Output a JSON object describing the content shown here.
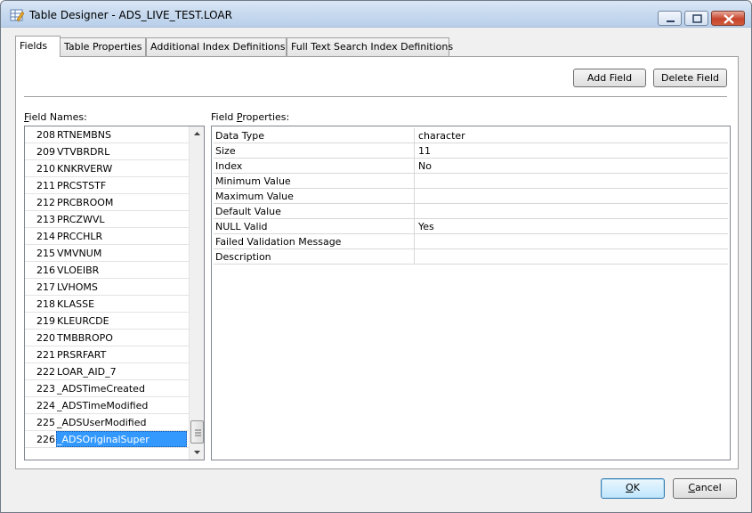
{
  "window": {
    "title": "Table Designer - ADS_LIVE_TEST.LOAR"
  },
  "tabs": [
    {
      "label": "Fields",
      "active": true
    },
    {
      "label": "Table Properties",
      "active": false
    },
    {
      "label": "Additional Index Definitions",
      "active": false
    },
    {
      "label": "Full Text Search Index Definitions",
      "active": false
    }
  ],
  "toolbar": {
    "add_field": "Add Field",
    "delete_field": "Delete Field"
  },
  "field_names": {
    "label_accel": "F",
    "label_rest": "ield Names:",
    "rows": [
      {
        "num": "208",
        "name": "RTNEMBNS"
      },
      {
        "num": "209",
        "name": "VTVBRDRL"
      },
      {
        "num": "210",
        "name": "KNKRVERW"
      },
      {
        "num": "211",
        "name": "PRCSTSTF"
      },
      {
        "num": "212",
        "name": "PRCBROOM"
      },
      {
        "num": "213",
        "name": "PRCZWVL"
      },
      {
        "num": "214",
        "name": "PRCCHLR"
      },
      {
        "num": "215",
        "name": "VMVNUM"
      },
      {
        "num": "216",
        "name": "VLOEIBR"
      },
      {
        "num": "217",
        "name": "LVHOMS"
      },
      {
        "num": "218",
        "name": "KLASSE"
      },
      {
        "num": "219",
        "name": "KLEURCDE"
      },
      {
        "num": "220",
        "name": "TMBBROPO"
      },
      {
        "num": "221",
        "name": "PRSRFART"
      },
      {
        "num": "222",
        "name": "LOAR_AID_7"
      },
      {
        "num": "223",
        "name": "_ADSTimeCreated"
      },
      {
        "num": "224",
        "name": "_ADSTimeModified"
      },
      {
        "num": "225",
        "name": "_ADSUserModified"
      },
      {
        "num": "226",
        "name": "_ADSOriginalSuper",
        "selected": true
      }
    ]
  },
  "field_properties": {
    "label_pre": "Field ",
    "label_accel": "P",
    "label_rest": "roperties:",
    "rows": [
      {
        "key": "Data Type",
        "value": "character"
      },
      {
        "key": "Size",
        "value": "11"
      },
      {
        "key": "Index",
        "value": "No"
      },
      {
        "key": "Minimum Value",
        "value": ""
      },
      {
        "key": "Maximum Value",
        "value": ""
      },
      {
        "key": "Default Value",
        "value": ""
      },
      {
        "key": "NULL Valid",
        "value": "Yes"
      },
      {
        "key": "Failed Validation Message",
        "value": ""
      },
      {
        "key": "Description",
        "value": ""
      }
    ]
  },
  "footer": {
    "ok_accel": "O",
    "ok_rest": "K",
    "cancel_accel": "C",
    "cancel_rest": "ancel"
  }
}
